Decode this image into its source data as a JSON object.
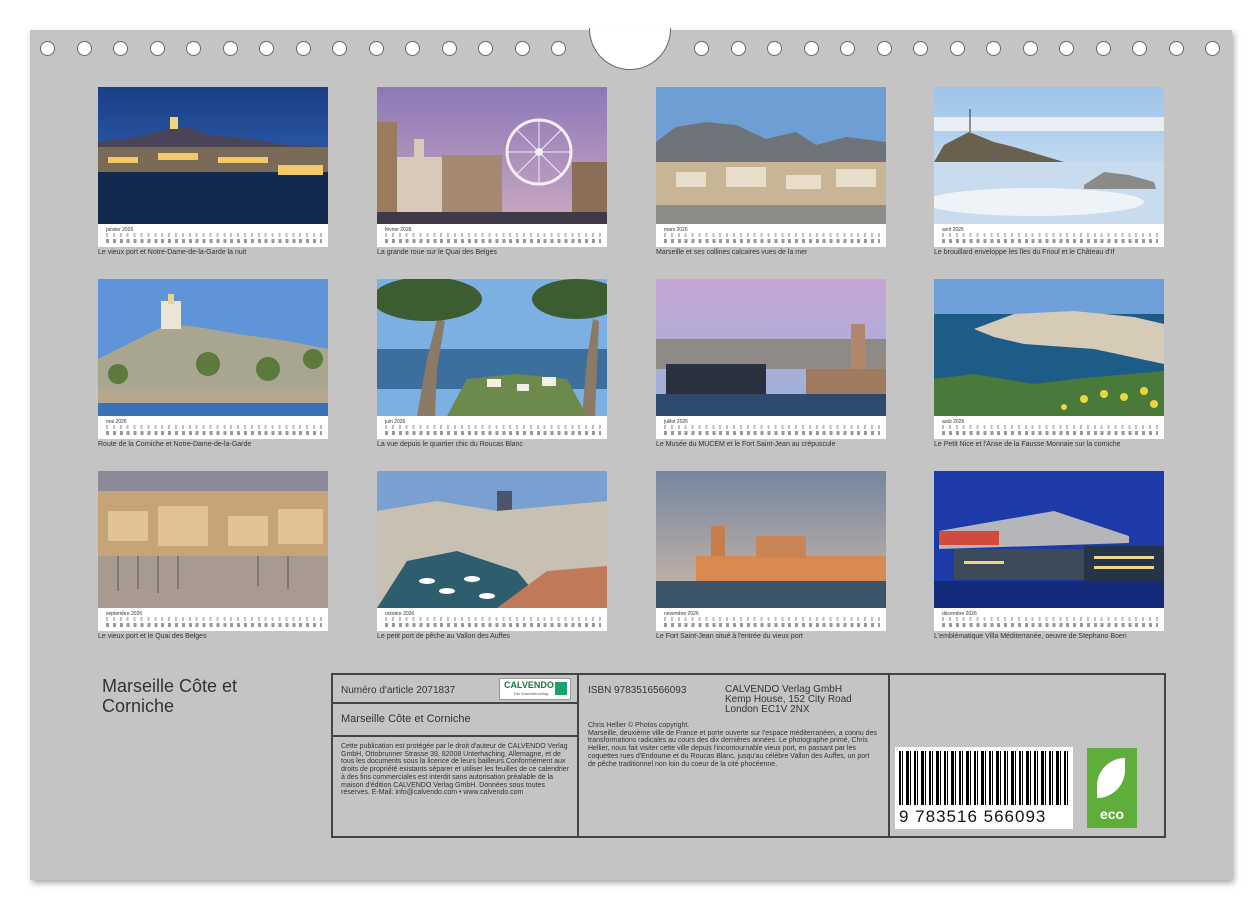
{
  "months": [
    {
      "name": "janvier 2026",
      "caption": "Le vieux port et Notre-Dame-de-la-Garde la nuit"
    },
    {
      "name": "février 2026",
      "caption": "La grande roue sur le Quai des Belges"
    },
    {
      "name": "mars 2026",
      "caption": "Marseille et ses collines calcaires vues de la mer"
    },
    {
      "name": "avril 2026",
      "caption": "Le brouillard enveloppe les îles du Frioul et le Château d'If"
    },
    {
      "name": "mai 2026",
      "caption": "Route de la Corniche et Notre-Dame-de-la-Garde"
    },
    {
      "name": "juin 2026",
      "caption": "La vue depuis le quartier chic du Roucas Blanc"
    },
    {
      "name": "juillet 2026",
      "caption": "Le Musée du MUCEM et le Fort Saint-Jean au crépuscule"
    },
    {
      "name": "août 2026",
      "caption": "Le Petit Nice et l'Anse de la Fausse Monnaie sur la corniche"
    },
    {
      "name": "septembre 2026",
      "caption": "Le vieux port et le Quai des Belges"
    },
    {
      "name": "octobre 2026",
      "caption": "Le petit port de pêche au Vallon des Auffes"
    },
    {
      "name": "novembre 2026",
      "caption": "Le Fort Saint-Jean situé à l'entrée du vieux port"
    },
    {
      "name": "décembre 2026",
      "caption": "L'emblématique Villa Méditerranée, oeuvre de Stephano Boeri"
    }
  ],
  "title_line1": "Marseille Côte et",
  "title_line2": "Corniche",
  "info": {
    "article": "Numéro d'article 2071837",
    "logo_word": "CALVENDO",
    "logo_sub": "Der Kalenderverlag",
    "title": "Marseille Côte et Corniche",
    "legal": "Cette publication est protégée par le droit d'auteur de CALVENDO Verlag GmbH, Ottobrunner Strasse 39, 82008 Unterhaching, Allemagne, et de tous les documents sous la licence de leurs bailleurs.Conformément aux droits de propriété existants séparer et utiliser les feuilles de ce calendrier à des fins commerciales est interdit sans autorisation préalable de la maison d'édition CALVENDO Verlag GmbH. Données sous toutes réserves. E-Mail: info@calvendo.com • www.calvendo.com",
    "isbn": "ISBN 9783516566093",
    "publisher_name": "CALVENDO Verlag GmbH",
    "publisher_addr1": "Kemp House, 152 City Road",
    "publisher_addr2": "London EC1V 2NX",
    "copyright": "Chris Hellier © Photos copyright.",
    "description": "Marseille, deuxième ville de France et porte ouverte sur l'espace méditerranéen, a connu des transformations radicales au cours des dix dernières années. Le photographe primé, Chris Hellier, nous fait visiter cette ville depuis l'incontournable vieux port, en passant par les coquettes rues d'Endoume et du Roucas Blanc, jusqu'au célèbre Vallon des Auffes, un port de pêche traditionnel non loin du coeur de la cité phocéenne.",
    "barcode_number": "9 783516 566093",
    "eco_label": "eco"
  }
}
